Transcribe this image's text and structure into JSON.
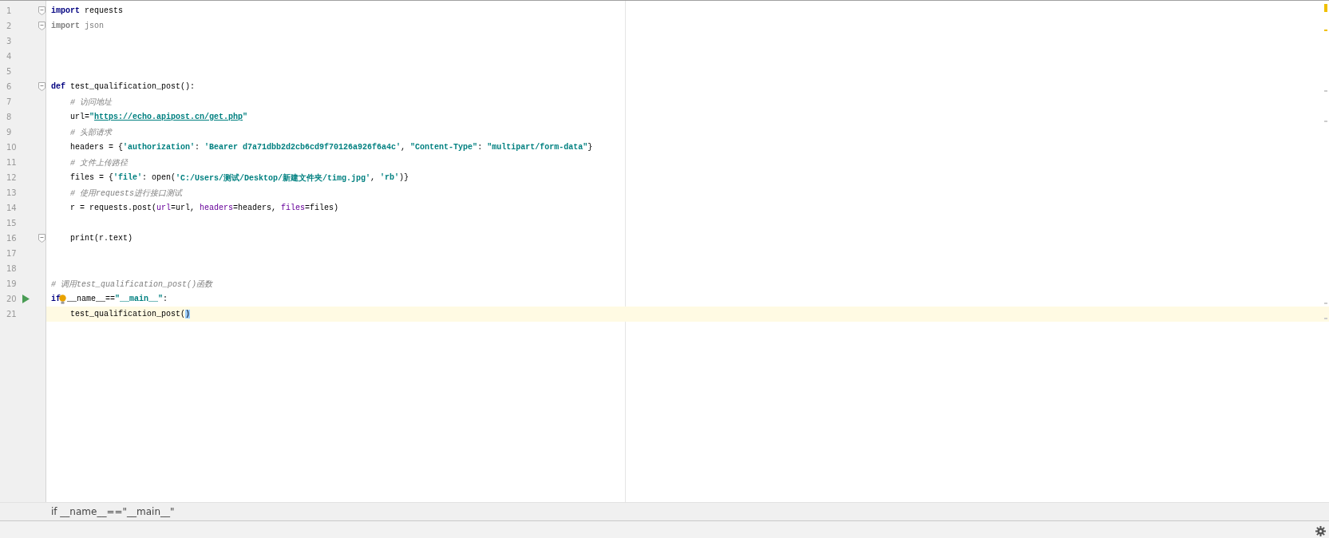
{
  "editor": {
    "lines": [
      {
        "number": "1",
        "fold": true,
        "run": false,
        "intention": false,
        "current": false,
        "indented": false,
        "tokens": [
          {
            "kind": "keyword",
            "text": "import"
          },
          {
            "kind": "plain",
            "text": " requests"
          }
        ]
      },
      {
        "number": "2",
        "fold": true,
        "run": false,
        "intention": false,
        "current": false,
        "indented": false,
        "tokens": [
          {
            "kind": "unused-keyword",
            "text": "import"
          },
          {
            "kind": "unused",
            "text": " json"
          }
        ]
      },
      {
        "number": "3",
        "fold": false,
        "run": false,
        "intention": false,
        "current": false
      },
      {
        "number": "4",
        "fold": false,
        "run": false,
        "intention": false,
        "current": false
      },
      {
        "number": "5",
        "fold": false,
        "run": false,
        "intention": false,
        "current": false
      },
      {
        "number": "6",
        "fold": true,
        "run": false,
        "intention": false,
        "current": false,
        "indented": false,
        "tokens": [
          {
            "kind": "keyword",
            "text": "def"
          },
          {
            "kind": "plain",
            "text": " test_qualification_post():"
          }
        ]
      },
      {
        "number": "7",
        "fold": false,
        "run": false,
        "intention": false,
        "current": false,
        "indented": true,
        "tokens": [
          {
            "kind": "comment",
            "text": "# 访问地址"
          }
        ]
      },
      {
        "number": "8",
        "fold": false,
        "run": false,
        "intention": false,
        "current": false,
        "indented": true,
        "tokens": [
          {
            "kind": "plain",
            "text": "url="
          },
          {
            "kind": "string",
            "text": "\""
          },
          {
            "kind": "link",
            "text": "https://echo.apipost.cn/get.php"
          },
          {
            "kind": "string",
            "text": "\""
          }
        ]
      },
      {
        "number": "9",
        "fold": false,
        "run": false,
        "intention": false,
        "current": false,
        "indented": true,
        "tokens": [
          {
            "kind": "comment",
            "text": "# 头部请求"
          }
        ]
      },
      {
        "number": "10",
        "fold": false,
        "run": false,
        "intention": false,
        "current": false,
        "indented": true,
        "tokens": [
          {
            "kind": "plain",
            "text": "headers = {"
          },
          {
            "kind": "string",
            "text": "'authorization'"
          },
          {
            "kind": "plain",
            "text": ": "
          },
          {
            "kind": "string",
            "text": "'Bearer d7a71dbb2d2cb6cd9f70126a926f6a4c'"
          },
          {
            "kind": "plain",
            "text": ", "
          },
          {
            "kind": "string",
            "text": "\"Content-Type\""
          },
          {
            "kind": "plain",
            "text": ": "
          },
          {
            "kind": "string",
            "text": "\"multipart/form-data\""
          },
          {
            "kind": "plain",
            "text": "}"
          }
        ]
      },
      {
        "number": "11",
        "fold": false,
        "run": false,
        "intention": false,
        "current": false,
        "indented": true,
        "tokens": [
          {
            "kind": "comment",
            "text": "# 文件上传路径"
          }
        ]
      },
      {
        "number": "12",
        "fold": false,
        "run": false,
        "intention": false,
        "current": false,
        "indented": true,
        "tokens": [
          {
            "kind": "plain",
            "text": "files = {"
          },
          {
            "kind": "string",
            "text": "'file'"
          },
          {
            "kind": "plain",
            "text": ": open("
          },
          {
            "kind": "string",
            "text": "'C:/Users/测试/Desktop/新建文件夹/timg.jpg'"
          },
          {
            "kind": "plain",
            "text": ", "
          },
          {
            "kind": "string",
            "text": "'rb'"
          },
          {
            "kind": "plain",
            "text": ")}"
          }
        ]
      },
      {
        "number": "13",
        "fold": false,
        "run": false,
        "intention": false,
        "current": false,
        "indented": true,
        "tokens": [
          {
            "kind": "comment",
            "text": "# 使用requests进行接口测试"
          }
        ]
      },
      {
        "number": "14",
        "fold": false,
        "run": false,
        "intention": false,
        "current": false,
        "indented": true,
        "tokens": [
          {
            "kind": "plain",
            "text": "r = requests.post("
          },
          {
            "kind": "param",
            "text": "url"
          },
          {
            "kind": "plain",
            "text": "=url, "
          },
          {
            "kind": "param",
            "text": "headers"
          },
          {
            "kind": "plain",
            "text": "=headers, "
          },
          {
            "kind": "param",
            "text": "files"
          },
          {
            "kind": "plain",
            "text": "=files)"
          }
        ]
      },
      {
        "number": "15",
        "fold": false,
        "run": false,
        "intention": false,
        "current": false
      },
      {
        "number": "16",
        "fold": true,
        "run": false,
        "intention": false,
        "current": false,
        "indented": true,
        "tokens": [
          {
            "kind": "plain",
            "text": "print(r.text)"
          }
        ]
      },
      {
        "number": "17",
        "fold": false,
        "run": false,
        "intention": false,
        "current": false
      },
      {
        "number": "18",
        "fold": false,
        "run": false,
        "intention": false,
        "current": false
      },
      {
        "number": "19",
        "fold": false,
        "run": false,
        "intention": false,
        "current": false,
        "indented": false,
        "tokens": [
          {
            "kind": "comment",
            "text": "# 调用test_qualification_post()函数"
          }
        ]
      },
      {
        "number": "20",
        "fold": false,
        "run": true,
        "intention": true,
        "current": false,
        "indented": false,
        "tokens": [
          {
            "kind": "keyword",
            "text": "if"
          },
          {
            "kind": "plain",
            "text": "__name__=="
          },
          {
            "kind": "string",
            "text": "\"__main__\""
          },
          {
            "kind": "plain",
            "text": ":"
          }
        ]
      },
      {
        "number": "21",
        "fold": false,
        "run": false,
        "intention": false,
        "current": true,
        "indented": true,
        "tokens": [
          {
            "kind": "plain",
            "text": "test_qualification_post("
          },
          {
            "kind": "match",
            "text": ")"
          }
        ]
      }
    ]
  },
  "breadcrumb": "if __name__==\"__main__\""
}
